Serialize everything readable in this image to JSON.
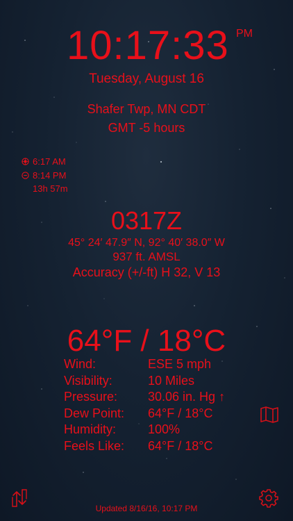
{
  "clock": {
    "time": "10:17:33",
    "ampm": "PM",
    "date": "Tuesday, August 16"
  },
  "location": {
    "place": "Shafer Twp, MN CDT",
    "gmt": "GMT -5 hours"
  },
  "sun": {
    "sunrise": "6:17 AM",
    "sunset": "8:14 PM",
    "day_length": "13h 57m"
  },
  "position": {
    "zulu": "0317Z",
    "coords": "45° 24′ 47.9″ N, 92° 40′ 38.0″ W",
    "altitude": "937 ft. AMSL",
    "accuracy": "Accuracy (+/-ft) H 32, V 13"
  },
  "weather": {
    "temp": "64°F / 18°C",
    "rows": [
      {
        "label": "Wind:",
        "value": "ESE 5 mph"
      },
      {
        "label": "Visibility:",
        "value": "10 Miles"
      },
      {
        "label": "Pressure:",
        "value": "30.06 in. Hg ↑"
      },
      {
        "label": "Dew Point:",
        "value": "64°F / 18°C"
      },
      {
        "label": "Humidity:",
        "value": "100%"
      },
      {
        "label": "Feels Like:",
        "value": "64°F / 18°C"
      }
    ]
  },
  "updated": "Updated 8/16/16, 10:17 PM",
  "icons": {
    "map": "map-icon",
    "swap": "swap-icon",
    "settings": "gear-icon",
    "sunrise": "sunrise-icon",
    "sunset": "sunset-icon"
  },
  "colors": {
    "accent": "#e8101a",
    "background": "#152232"
  }
}
